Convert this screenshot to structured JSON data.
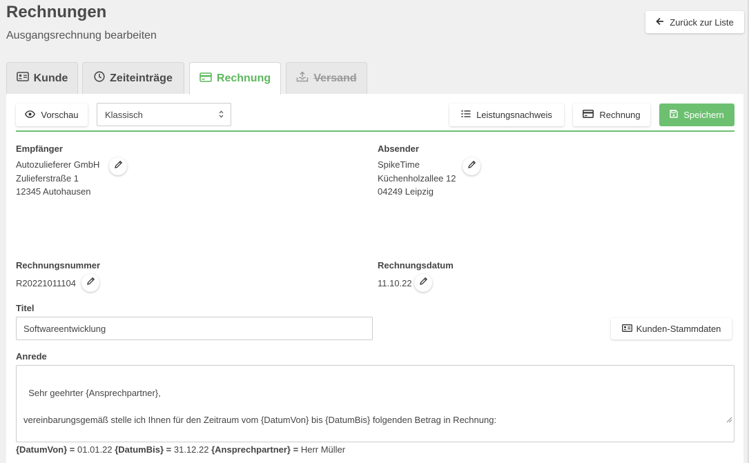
{
  "header": {
    "title": "Rechnungen",
    "subtitle": "Ausgangsrechnung bearbeiten",
    "back_label": "Zurück zur Liste"
  },
  "tabs": [
    {
      "label": "Kunde",
      "icon": "id-card-icon",
      "state": "normal"
    },
    {
      "label": "Zeiteinträge",
      "icon": "clock-icon",
      "state": "normal"
    },
    {
      "label": "Rechnung",
      "icon": "credit-card-icon",
      "state": "active"
    },
    {
      "label": "Versand",
      "icon": "upload-tray-icon",
      "state": "disabled"
    }
  ],
  "toolbar": {
    "preview_label": "Vorschau",
    "template_select_value": "Klassisch",
    "service_record_label": "Leistungsnachweis",
    "invoice_label": "Rechnung",
    "save_label": "Speichern"
  },
  "recipient": {
    "label": "Empfänger",
    "line1": "Autozulieferer GmbH",
    "line2": "Zulieferstraße 1",
    "line3": "12345 Autohausen"
  },
  "sender": {
    "label": "Absender",
    "line1": "SpikeTime",
    "line2": "Küchenholzallee 12",
    "line3": "04249 Leipzig"
  },
  "invoice_number": {
    "label": "Rechnungsnummer",
    "value": "R20221011104"
  },
  "invoice_date": {
    "label": "Rechnungsdatum",
    "value": "11.10.22"
  },
  "title_field": {
    "label": "Titel",
    "value": "Softwareentwicklung"
  },
  "customer_master_label": "Kunden-Stammdaten",
  "salutation": {
    "label": "Anrede",
    "value": "Sehr geehrter {Ansprechpartner},\n\nvereinbarungsgemäß stelle ich Ihnen für den Zeitraum vom {DatumVon} bis {DatumBis} folgenden Betrag in Rechnung:"
  },
  "placeholders": {
    "date_from_key": "{DatumVon}",
    "date_from_value": "01.01.22",
    "date_to_key": "{DatumBis}",
    "date_to_value": "31.12.22",
    "contact_key": "{Ansprechpartner}",
    "contact_value": "Herr Müller",
    "equals": "="
  },
  "colors": {
    "accent_green": "#6cc070",
    "active_tab_text": "#5cb85c"
  }
}
